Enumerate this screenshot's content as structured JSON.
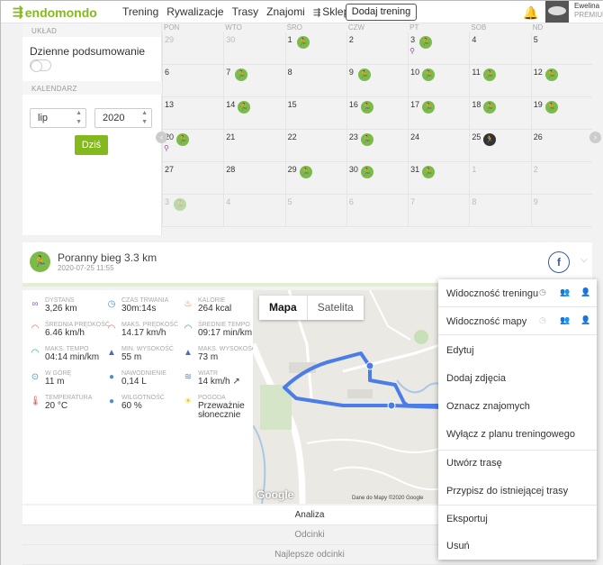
{
  "header": {
    "logo_text": "endomondo",
    "nav": [
      "Trening",
      "Rywalizacje",
      "Trasy",
      "Znajomi",
      "Sklep"
    ],
    "add_training": "Dodaj trening",
    "user_name": "Ewelina",
    "user_badge": "PREMIUM"
  },
  "sidebar": {
    "section_layout": "UKŁAD",
    "daily_summary": "Dzienne podsumowanie",
    "section_calendar": "KALENDARZ",
    "month": "lip",
    "year": "2020",
    "today": "Dziś"
  },
  "calendar": {
    "days_of_week": [
      "PON",
      "WTO",
      "ŚRO",
      "CZW",
      "PT",
      "SOB",
      "ND"
    ],
    "weeks": [
      [
        {
          "d": "29",
          "o": true
        },
        {
          "d": "30",
          "o": true
        },
        {
          "d": "1",
          "w": true
        },
        {
          "d": "2"
        },
        {
          "d": "3",
          "w": true,
          "p": true
        },
        {
          "d": "4"
        },
        {
          "d": "5"
        }
      ],
      [
        {
          "d": "6"
        },
        {
          "d": "7",
          "w": true
        },
        {
          "d": "8"
        },
        {
          "d": "9",
          "w": true
        },
        {
          "d": "10",
          "w": true
        },
        {
          "d": "11",
          "w": true
        },
        {
          "d": "12",
          "w": true
        }
      ],
      [
        {
          "d": "13"
        },
        {
          "d": "14",
          "w": true
        },
        {
          "d": "15"
        },
        {
          "d": "16",
          "w": true
        },
        {
          "d": "17",
          "w": true
        },
        {
          "d": "18",
          "w": true
        },
        {
          "d": "19",
          "w": true
        }
      ],
      [
        {
          "d": "20",
          "w": true,
          "p": true
        },
        {
          "d": "21"
        },
        {
          "d": "22"
        },
        {
          "d": "23",
          "w": true
        },
        {
          "d": "24"
        },
        {
          "d": "25",
          "w": true,
          "dark": true
        },
        {
          "d": "26"
        }
      ],
      [
        {
          "d": "27"
        },
        {
          "d": "28"
        },
        {
          "d": "29",
          "w": true
        },
        {
          "d": "30",
          "w": true
        },
        {
          "d": "31",
          "w": true
        },
        {
          "d": "1",
          "o": true
        },
        {
          "d": "2",
          "o": true
        }
      ],
      [
        {
          "d": "3",
          "o": true,
          "w": true,
          "f": true
        },
        {
          "d": "4",
          "o": true
        },
        {
          "d": "5",
          "o": true
        },
        {
          "d": "6",
          "o": true
        },
        {
          "d": "7",
          "o": true
        },
        {
          "d": "8",
          "o": true
        },
        {
          "d": "9",
          "o": true
        }
      ]
    ]
  },
  "activity": {
    "title": "Poranny bieg 3.3 km",
    "date": "2020-07-25 11:55",
    "fb": "f"
  },
  "stats": [
    {
      "label": "DYSTANS",
      "value": "3,26 km",
      "icon": "distance-icon",
      "color": "#8b5fbf"
    },
    {
      "label": "CZAS TRWANIA",
      "value": "30m:14s",
      "icon": "clock-icon",
      "color": "#4a90d9"
    },
    {
      "label": "KALORIE",
      "value": "264 kcal",
      "icon": "flame-icon",
      "color": "#e8663a"
    },
    {
      "label": "ŚREDNIA PRĘDKOŚĆ",
      "value": "6.46 km/h",
      "icon": "speed-icon",
      "color": "#e8663a"
    },
    {
      "label": "MAKS. PRĘDKOŚĆ",
      "value": "14.17 km/h",
      "icon": "speed-icon",
      "color": "#e8663a"
    },
    {
      "label": "ŚREDNIE TEMPO",
      "value": "09:17 min/km",
      "icon": "pace-icon",
      "color": "#2aa876"
    },
    {
      "label": "MAKS. TEMPO",
      "value": "04:14 min/km",
      "icon": "pace-icon",
      "color": "#2aa876"
    },
    {
      "label": "MIN. WYSOKOŚĆ",
      "value": "55 m",
      "icon": "mountain-icon",
      "color": "#4a6fb5"
    },
    {
      "label": "MAKS. WYSOKOŚĆ",
      "value": "73 m",
      "icon": "mountain-icon",
      "color": "#4a6fb5"
    },
    {
      "label": "W GÓRĘ",
      "value": "11 m",
      "icon": "ascent-icon",
      "color": "#4a90d9"
    },
    {
      "label": "NAWODNIENIE",
      "value": "0,14 L",
      "icon": "drop-icon",
      "color": "#4a90d9"
    },
    {
      "label": "WIATR",
      "value": "14 km/h ↗",
      "icon": "wind-icon",
      "color": "#4a90d9"
    },
    {
      "label": "TEMPERATURA",
      "value": "20 °C",
      "icon": "thermometer-icon",
      "color": "#d9534f"
    },
    {
      "label": "WILGOTNOŚĆ",
      "value": "60 %",
      "icon": "humidity-icon",
      "color": "#4a90d9"
    },
    {
      "label": "POGODA",
      "value": "Przeważnie słonecznie",
      "icon": "sun-icon",
      "color": "#f0c419"
    }
  ],
  "map": {
    "tab_map": "Mapa",
    "tab_satellite": "Satelita",
    "google": "Google",
    "copyright": "Dane do Mapy ©2020 Google",
    "route_color": "#4a7de8"
  },
  "bottom_tabs": [
    "Analiza",
    "Odcinki",
    "Najlepsze odcinki"
  ],
  "menu": {
    "visibility_training": "Widoczność treningu",
    "visibility_map": "Widoczność mapy",
    "items_a": [
      "Edytuj",
      "Dodaj zdjęcia",
      "Oznacz znajomych",
      "Wyłącz z planu treningowego"
    ],
    "items_b": [
      "Utwórz trasę",
      "Przypisz do istniejącej trasy"
    ],
    "items_c": [
      "Eksportuj",
      "Usuń"
    ]
  }
}
